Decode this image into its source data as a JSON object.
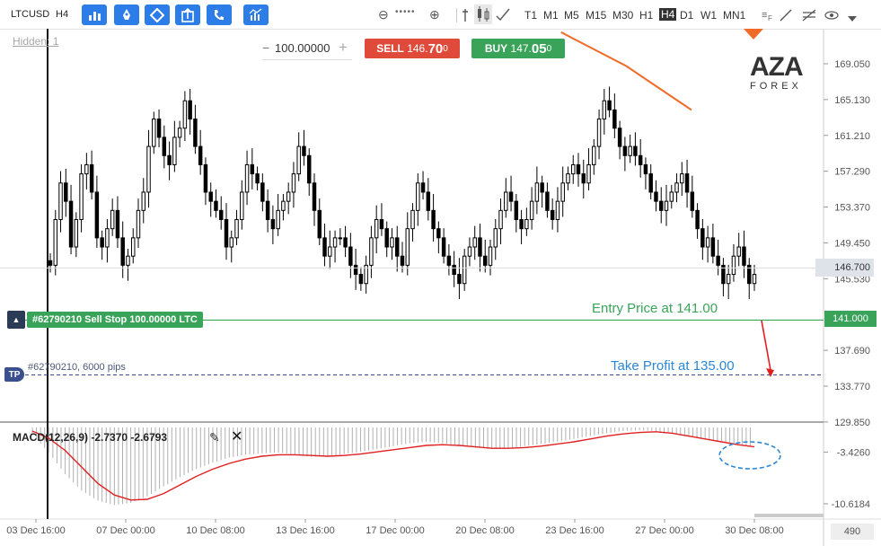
{
  "toolbar": {
    "symbol": "LTCUSD",
    "timeframe": "H4",
    "buttons": [
      "bar-chart-icon",
      "rocket-icon",
      "diamond-icon",
      "export-icon",
      "phone-icon",
      "indicators-icon"
    ],
    "zoom_out": "⊖",
    "zoom_dots": "•••••",
    "zoom_in": "⊕",
    "timeframes": [
      "T1",
      "M1",
      "M5",
      "M15",
      "M30",
      "H1",
      "H4",
      "D1",
      "W1",
      "MN1"
    ],
    "active_timeframe": "H4"
  },
  "chart": {
    "hidden_label": "Hidden: 1",
    "quantity": "100.00000",
    "sell": {
      "label": "SELL",
      "price_main": "146.",
      "price_big": "70",
      "price_small": "0"
    },
    "buy": {
      "label": "BUY",
      "price_main": "147.",
      "price_big": "05",
      "price_small": "0"
    },
    "logo_top": "AZA",
    "logo_bottom": "FOREX",
    "current_price": "146.700",
    "entry_price_tag": "141.000",
    "order_label": "#62790210 Sell Stop 100.00000 LTC",
    "tp_text": "#62790210, 6000 pips",
    "tp_icon": "TP",
    "entry_annotation": "Entry Price at 141.00",
    "tp_annotation": "Take Profit at 135.00",
    "bars_count": "490",
    "colors": {
      "up": "#ffffff",
      "down": "#000000",
      "entry": "#3aa35a",
      "tp": "#3a4f8f",
      "ma": "#f06a28",
      "macd_signal": "#e02020",
      "macd_hist": "#b0b0b0"
    }
  },
  "chart_data": [
    {
      "type": "candlestick",
      "title": "LTCUSD H4",
      "y_ticks": [
        "169.050",
        "165.130",
        "161.210",
        "157.290",
        "153.370",
        "149.450",
        "145.530",
        "141.000",
        "137.690",
        "133.770",
        "129.850"
      ],
      "x_ticks": [
        "03 Dec 16:00",
        "07 Dec 00:00",
        "10 Dec 08:00",
        "13 Dec 16:00",
        "17 Dec 00:00",
        "20 Dec 08:00",
        "23 Dec 16:00",
        "27 Dec 00:00",
        "30 Dec 08:00"
      ],
      "ylim": [
        129.85,
        172.0
      ],
      "closes": [
        147,
        152,
        156,
        154,
        149,
        152,
        157,
        158,
        155,
        150,
        149,
        151,
        153,
        150,
        147,
        148,
        150,
        153,
        155,
        160,
        163,
        161,
        159,
        158,
        161,
        162,
        165,
        163,
        160,
        158,
        155,
        154,
        153,
        152,
        149,
        150,
        152,
        155,
        158,
        157,
        156,
        154,
        152,
        151,
        153,
        154,
        155,
        157,
        160,
        159,
        156,
        153,
        150,
        148,
        149,
        150,
        150,
        149,
        147,
        146,
        145,
        147,
        150,
        152,
        151,
        149,
        150,
        148,
        147,
        151,
        153,
        156,
        155,
        153,
        151,
        150,
        148,
        147,
        146,
        145,
        148,
        149,
        150,
        148,
        147,
        149,
        151,
        153,
        155,
        154,
        152,
        151,
        152,
        154,
        156,
        155,
        153,
        152,
        154,
        156,
        157,
        158,
        157,
        156,
        158,
        160,
        163,
        165,
        164,
        162,
        160,
        159,
        160,
        159,
        158,
        157,
        155,
        154,
        153,
        154,
        155,
        156,
        157,
        155,
        153,
        151,
        149,
        150,
        148,
        147,
        145,
        146,
        148,
        149,
        147,
        145,
        146
      ],
      "indicator_lines": [
        {
          "name": "Entry Price",
          "value": 141.0
        },
        {
          "name": "Take Profit",
          "value": 135.0
        }
      ],
      "moving_average": [
        [
          0.68,
          172.5
        ],
        [
          0.76,
          168.8
        ],
        [
          0.84,
          164.0
        ]
      ]
    },
    {
      "type": "bar",
      "title": "MACD(12,26,9) -2.7370 -2.6793",
      "series": [
        {
          "name": "MACD",
          "values": [
            -1.0,
            -3.5,
            -6.5,
            -8.8,
            -10.2,
            -10.8,
            -10.5,
            -9.6,
            -8.2,
            -6.9,
            -5.8,
            -4.9,
            -4.2,
            -3.8,
            -3.6,
            -3.5,
            -3.8,
            -4.1,
            -4.0,
            -3.7,
            -3.4,
            -3.0,
            -2.6,
            -2.2,
            -2.0,
            -2.2,
            -2.5,
            -2.8,
            -3.0,
            -2.9,
            -2.6,
            -2.3,
            -2.0,
            -1.6,
            -1.2,
            -0.8,
            -0.5,
            -0.4,
            -0.5,
            -0.9,
            -1.3,
            -1.6,
            -1.9,
            -2.3,
            -2.7
          ]
        },
        {
          "name": "Signal",
          "values": [
            -0.5,
            -1.5,
            -3.2,
            -5.5,
            -7.8,
            -9.4,
            -10.1,
            -10.0,
            -9.2,
            -8.0,
            -6.8,
            -5.8,
            -5.0,
            -4.4,
            -4.0,
            -3.8,
            -3.8,
            -3.9,
            -4.0,
            -3.9,
            -3.7,
            -3.4,
            -3.1,
            -2.8,
            -2.5,
            -2.4,
            -2.5,
            -2.7,
            -2.9,
            -2.9,
            -2.8,
            -2.6,
            -2.3,
            -2.0,
            -1.6,
            -1.2,
            -0.9,
            -0.7,
            -0.6,
            -0.8,
            -1.2,
            -1.6,
            -2.0,
            -2.4,
            -2.7
          ]
        }
      ],
      "y_ticks": [
        "-3.4260",
        "-10.6184"
      ],
      "ylim": [
        -12.0,
        0.5
      ]
    }
  ]
}
